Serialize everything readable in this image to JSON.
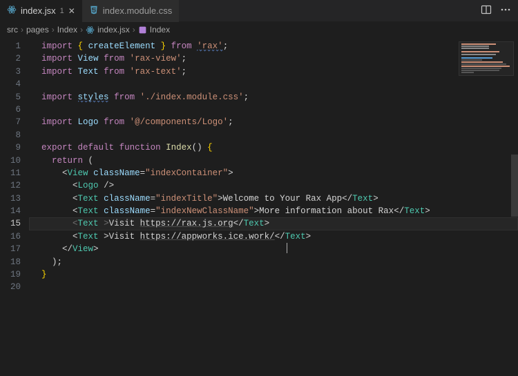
{
  "tabs": [
    {
      "label": "index.jsx",
      "badge": "1",
      "active": true
    },
    {
      "label": "index.module.css",
      "badge": "",
      "active": false
    }
  ],
  "breadcrumb": {
    "parts": [
      "src",
      "pages",
      "Index",
      "index.jsx",
      "Index"
    ]
  },
  "editor": {
    "current_line": 15,
    "lines": [
      {
        "n": 1,
        "segs": [
          {
            "cls": "tok-kw",
            "t": "import"
          },
          {
            "cls": "tok-plain",
            "t": " "
          },
          {
            "cls": "tok-brace",
            "t": "{"
          },
          {
            "cls": "tok-plain",
            "t": " "
          },
          {
            "cls": "tok-id",
            "t": "createElement"
          },
          {
            "cls": "tok-plain",
            "t": " "
          },
          {
            "cls": "tok-brace",
            "t": "}"
          },
          {
            "cls": "tok-plain",
            "t": " "
          },
          {
            "cls": "tok-kw",
            "t": "from"
          },
          {
            "cls": "tok-plain",
            "t": " "
          },
          {
            "cls": "tok-str squiggle",
            "t": "'rax'"
          },
          {
            "cls": "tok-punc",
            "t": ";"
          }
        ]
      },
      {
        "n": 2,
        "segs": [
          {
            "cls": "tok-kw",
            "t": "import"
          },
          {
            "cls": "tok-plain",
            "t": " "
          },
          {
            "cls": "tok-id",
            "t": "View"
          },
          {
            "cls": "tok-plain",
            "t": " "
          },
          {
            "cls": "tok-kw",
            "t": "from"
          },
          {
            "cls": "tok-plain",
            "t": " "
          },
          {
            "cls": "tok-str",
            "t": "'rax-view'"
          },
          {
            "cls": "tok-punc",
            "t": ";"
          }
        ]
      },
      {
        "n": 3,
        "segs": [
          {
            "cls": "tok-kw",
            "t": "import"
          },
          {
            "cls": "tok-plain",
            "t": " "
          },
          {
            "cls": "tok-id",
            "t": "Text"
          },
          {
            "cls": "tok-plain",
            "t": " "
          },
          {
            "cls": "tok-kw",
            "t": "from"
          },
          {
            "cls": "tok-plain",
            "t": " "
          },
          {
            "cls": "tok-str",
            "t": "'rax-text'"
          },
          {
            "cls": "tok-punc",
            "t": ";"
          }
        ]
      },
      {
        "n": 4,
        "segs": []
      },
      {
        "n": 5,
        "segs": [
          {
            "cls": "tok-kw",
            "t": "import"
          },
          {
            "cls": "tok-plain",
            "t": " "
          },
          {
            "cls": "tok-id squiggle",
            "t": "styles"
          },
          {
            "cls": "tok-plain",
            "t": " "
          },
          {
            "cls": "tok-kw",
            "t": "from"
          },
          {
            "cls": "tok-plain",
            "t": " "
          },
          {
            "cls": "tok-str",
            "t": "'./index.module.css'"
          },
          {
            "cls": "tok-punc",
            "t": ";"
          }
        ]
      },
      {
        "n": 6,
        "segs": []
      },
      {
        "n": 7,
        "segs": [
          {
            "cls": "tok-kw",
            "t": "import"
          },
          {
            "cls": "tok-plain",
            "t": " "
          },
          {
            "cls": "tok-id",
            "t": "Logo"
          },
          {
            "cls": "tok-plain",
            "t": " "
          },
          {
            "cls": "tok-kw",
            "t": "from"
          },
          {
            "cls": "tok-plain",
            "t": " "
          },
          {
            "cls": "tok-str",
            "t": "'@/components/Logo'"
          },
          {
            "cls": "tok-punc",
            "t": ";"
          }
        ]
      },
      {
        "n": 8,
        "segs": []
      },
      {
        "n": 9,
        "segs": [
          {
            "cls": "tok-kw",
            "t": "export"
          },
          {
            "cls": "tok-plain",
            "t": " "
          },
          {
            "cls": "tok-kw",
            "t": "default"
          },
          {
            "cls": "tok-plain",
            "t": " "
          },
          {
            "cls": "tok-kw",
            "t": "function"
          },
          {
            "cls": "tok-plain",
            "t": " "
          },
          {
            "cls": "tok-fnname",
            "t": "Index"
          },
          {
            "cls": "tok-punc",
            "t": "()"
          },
          {
            "cls": "tok-plain",
            "t": " "
          },
          {
            "cls": "tok-brace",
            "t": "{"
          }
        ]
      },
      {
        "n": 10,
        "segs": [
          {
            "cls": "tok-plain",
            "t": "  "
          },
          {
            "cls": "tok-kw",
            "t": "return"
          },
          {
            "cls": "tok-plain",
            "t": " "
          },
          {
            "cls": "tok-punc",
            "t": "("
          }
        ]
      },
      {
        "n": 11,
        "segs": [
          {
            "cls": "tok-plain",
            "t": "    "
          },
          {
            "cls": "tok-punc",
            "t": "<"
          },
          {
            "cls": "tok-tag",
            "t": "View"
          },
          {
            "cls": "tok-plain",
            "t": " "
          },
          {
            "cls": "tok-attr",
            "t": "className"
          },
          {
            "cls": "tok-punc",
            "t": "="
          },
          {
            "cls": "tok-str",
            "t": "\"indexContainer\""
          },
          {
            "cls": "tok-punc",
            "t": ">"
          }
        ]
      },
      {
        "n": 12,
        "segs": [
          {
            "cls": "tok-plain",
            "t": "      "
          },
          {
            "cls": "tok-punc",
            "t": "<"
          },
          {
            "cls": "tok-tag",
            "t": "Logo"
          },
          {
            "cls": "tok-plain",
            "t": " "
          },
          {
            "cls": "tok-punc",
            "t": "/>"
          }
        ]
      },
      {
        "n": 13,
        "segs": [
          {
            "cls": "tok-plain",
            "t": "      "
          },
          {
            "cls": "tok-punc",
            "t": "<"
          },
          {
            "cls": "tok-tag",
            "t": "Text"
          },
          {
            "cls": "tok-plain",
            "t": " "
          },
          {
            "cls": "tok-attr",
            "t": "className"
          },
          {
            "cls": "tok-punc",
            "t": "="
          },
          {
            "cls": "tok-str",
            "t": "\"indexTitle\""
          },
          {
            "cls": "tok-punc",
            "t": ">"
          },
          {
            "cls": "tok-plain",
            "t": "Welcome to Your Rax App"
          },
          {
            "cls": "tok-punc",
            "t": "</"
          },
          {
            "cls": "tok-tag",
            "t": "Text"
          },
          {
            "cls": "tok-punc",
            "t": ">"
          }
        ]
      },
      {
        "n": 14,
        "segs": [
          {
            "cls": "tok-plain",
            "t": "      "
          },
          {
            "cls": "tok-punc",
            "t": "<"
          },
          {
            "cls": "tok-tag",
            "t": "Text"
          },
          {
            "cls": "tok-plain",
            "t": " "
          },
          {
            "cls": "tok-attr",
            "t": "className"
          },
          {
            "cls": "tok-punc",
            "t": "="
          },
          {
            "cls": "tok-str",
            "t": "\"indexNewClassName\""
          },
          {
            "cls": "tok-punc",
            "t": ">"
          },
          {
            "cls": "tok-plain",
            "t": "More information about Rax"
          },
          {
            "cls": "tok-punc",
            "t": "</"
          },
          {
            "cls": "tok-tag",
            "t": "Text"
          },
          {
            "cls": "tok-punc",
            "t": ">"
          }
        ]
      },
      {
        "n": 15,
        "segs": [
          {
            "cls": "tok-plain",
            "t": "      "
          },
          {
            "cls": "guard-br",
            "t": "<"
          },
          {
            "cls": "tok-tag",
            "t": "Text"
          },
          {
            "cls": "tok-plain",
            "t": " "
          },
          {
            "cls": "guard-br",
            "t": ">"
          },
          {
            "cls": "tok-plain",
            "t": "Visit "
          },
          {
            "cls": "tok-link",
            "t": "https://rax.js.org"
          },
          {
            "cls": "tok-punc",
            "t": "</"
          },
          {
            "cls": "tok-tag",
            "t": "Text"
          },
          {
            "cls": "tok-punc",
            "t": ">"
          }
        ]
      },
      {
        "n": 16,
        "segs": [
          {
            "cls": "tok-plain",
            "t": "      "
          },
          {
            "cls": "tok-punc",
            "t": "<"
          },
          {
            "cls": "tok-tag",
            "t": "Text"
          },
          {
            "cls": "tok-plain",
            "t": " "
          },
          {
            "cls": "tok-punc",
            "t": ">"
          },
          {
            "cls": "tok-plain",
            "t": "Visit "
          },
          {
            "cls": "tok-link",
            "t": "https://appworks.ice.work/"
          },
          {
            "cls": "tok-punc",
            "t": "</"
          },
          {
            "cls": "tok-tag",
            "t": "Text"
          },
          {
            "cls": "tok-punc",
            "t": ">"
          }
        ]
      },
      {
        "n": 17,
        "segs": [
          {
            "cls": "tok-plain",
            "t": "    "
          },
          {
            "cls": "tok-punc",
            "t": "</"
          },
          {
            "cls": "tok-tag",
            "t": "View"
          },
          {
            "cls": "tok-punc",
            "t": ">"
          }
        ]
      },
      {
        "n": 18,
        "segs": [
          {
            "cls": "tok-plain",
            "t": "  "
          },
          {
            "cls": "tok-punc",
            "t": ");"
          }
        ]
      },
      {
        "n": 19,
        "segs": [
          {
            "cls": "tok-brace",
            "t": "}"
          }
        ]
      },
      {
        "n": 20,
        "segs": []
      }
    ]
  }
}
